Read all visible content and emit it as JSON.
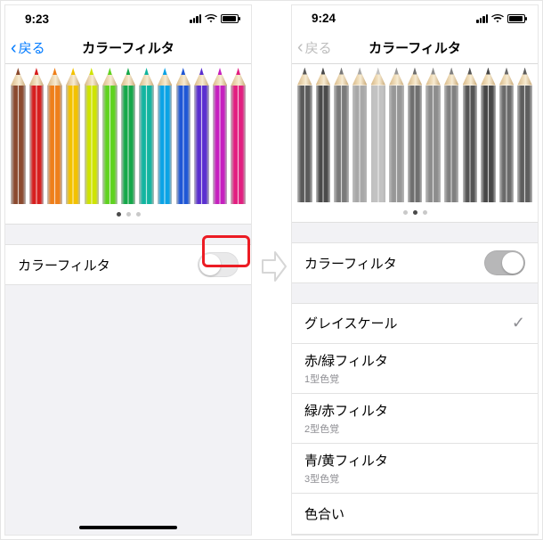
{
  "left": {
    "time": "9:23",
    "nav_back": "戻る",
    "nav_title": "カラーフィルタ",
    "pencil_colors": [
      "#8b4a2f",
      "#d71f1f",
      "#ef7f1a",
      "#f3c200",
      "#cfe400",
      "#5fd31f",
      "#15a84a",
      "#12b5a0",
      "#0aa3e6",
      "#1f57d6",
      "#5a2fd0",
      "#c61fbf",
      "#e21f80"
    ],
    "pager_active": 0,
    "toggle_label": "カラーフィルタ",
    "toggle_on": false
  },
  "right": {
    "time": "9:24",
    "nav_back": "戻る",
    "nav_title": "カラーフィルタ",
    "pencil_colors": [
      "#5a5a5a",
      "#4a4a4a",
      "#7a7a7a",
      "#a8a8a8",
      "#c2c2c2",
      "#979797",
      "#6f6f6f",
      "#8d8d8d",
      "#808080",
      "#555555",
      "#474747",
      "#6a6a6a",
      "#5e5e5e"
    ],
    "pager_active": 1,
    "toggle_label": "カラーフィルタ",
    "toggle_on": true,
    "options": [
      {
        "label": "グレイスケール",
        "sub": "",
        "checked": true
      },
      {
        "label": "赤/緑フィルタ",
        "sub": "1型色覚",
        "checked": false
      },
      {
        "label": "緑/赤フィルタ",
        "sub": "2型色覚",
        "checked": false
      },
      {
        "label": "青/黄フィルタ",
        "sub": "3型色覚",
        "checked": false
      },
      {
        "label": "色合い",
        "sub": "",
        "checked": false
      }
    ]
  }
}
